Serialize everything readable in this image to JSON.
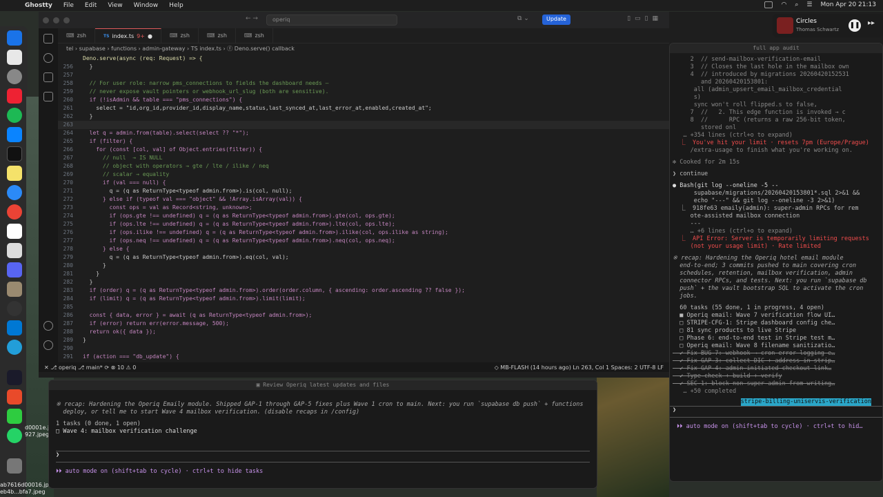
{
  "menubar": {
    "app": "Ghostty",
    "items": [
      "File",
      "Edit",
      "View",
      "Window",
      "Help"
    ],
    "datetime": "Mon Apr 20  21:13"
  },
  "music": {
    "title": "Circles",
    "artist": "Thomas Schwartz"
  },
  "desktop": {
    "files": [
      "ab7616d00016.jpeg",
      "eb4b...bfa7.jpeg",
      "d0001e.jpeg",
      "927.jpeg"
    ]
  },
  "vscode": {
    "search_placeholder": "operiq",
    "update_label": "Update",
    "tabs": [
      {
        "label": "zsh"
      },
      {
        "label": "index.ts",
        "badge": "9+",
        "active": true
      },
      {
        "label": "zsh"
      },
      {
        "label": "zsh"
      },
      {
        "label": "zsh"
      }
    ],
    "breadcrumb": "tel  ›  supabase  ›  functions  ›  admin-gateway  ›  TS index.ts  ›  ⓕ Deno.serve() callback",
    "header_line": "Deno.serve(async (req: Request) => {",
    "lines": [
      {
        "n": "256",
        "t": "  }"
      },
      {
        "n": "257",
        "t": ""
      },
      {
        "n": "258",
        "t": "  // For user role: narrow pms_connections to fields the dashboard needs —",
        "c": "cm"
      },
      {
        "n": "259",
        "t": "  // never expose vault pointers or webhook_url_slug (both are sensitive).",
        "c": "cm"
      },
      {
        "n": "260",
        "t": "  if (!isAdmin && table === \"pms_connections\") {"
      },
      {
        "n": "261",
        "t": "    select = \"id,org_id,provider_id,display_name,status,last_synced_at,last_error_at,enabled,created_at\";"
      },
      {
        "n": "262",
        "t": "  }"
      },
      {
        "n": "263",
        "t": ""
      },
      {
        "n": "264",
        "t": "  let q = admin.from(table).select(select ?? \"*\");"
      },
      {
        "n": "265",
        "t": "  if (filter) {"
      },
      {
        "n": "266",
        "t": "    for (const [col, val] of Object.entries(filter)) {"
      },
      {
        "n": "267",
        "t": "      // null  → IS NULL",
        "c": "cm"
      },
      {
        "n": "268",
        "t": "      // object with operators → gte / lte / ilike / neq",
        "c": "cm"
      },
      {
        "n": "269",
        "t": "      // scalar → equality",
        "c": "cm"
      },
      {
        "n": "270",
        "t": "      if (val === null) {"
      },
      {
        "n": "271",
        "t": "        q = (q as ReturnType<typeof admin.from>).is(col, null);"
      },
      {
        "n": "272",
        "t": "      } else if (typeof val === \"object\" && !Array.isArray(val)) {"
      },
      {
        "n": "273",
        "t": "        const ops = val as Record<string, unknown>;"
      },
      {
        "n": "274",
        "t": "        if (ops.gte !== undefined) q = (q as ReturnType<typeof admin.from>).gte(col, ops.gte);"
      },
      {
        "n": "275",
        "t": "        if (ops.lte !== undefined) q = (q as ReturnType<typeof admin.from>).lte(col, ops.lte);"
      },
      {
        "n": "276",
        "t": "        if (ops.ilike !== undefined) q = (q as ReturnType<typeof admin.from>).ilike(col, ops.ilike as string);"
      },
      {
        "n": "277",
        "t": "        if (ops.neq !== undefined) q = (q as ReturnType<typeof admin.from>).neq(col, ops.neq);"
      },
      {
        "n": "278",
        "t": "      } else {"
      },
      {
        "n": "279",
        "t": "        q = (q as ReturnType<typeof admin.from>).eq(col, val);"
      },
      {
        "n": "280",
        "t": "      }"
      },
      {
        "n": "281",
        "t": "    }"
      },
      {
        "n": "282",
        "t": "  }"
      },
      {
        "n": "283",
        "t": "  if (order) q = (q as ReturnType<typeof admin.from>).order(order.column, { ascending: order.ascending ?? false });"
      },
      {
        "n": "284",
        "t": "  if (limit) q = (q as ReturnType<typeof admin.from>).limit(limit);"
      },
      {
        "n": "285",
        "t": ""
      },
      {
        "n": "286",
        "t": "  const { data, error } = await (q as ReturnType<typeof admin.from>);"
      },
      {
        "n": "287",
        "t": "  if (error) return err(error.message, 500);"
      },
      {
        "n": "288",
        "t": "  return ok({ data });"
      },
      {
        "n": "289",
        "t": "}"
      },
      {
        "n": "290",
        "t": ""
      },
      {
        "n": "291",
        "t": "if (action === \"db_update\") {"
      }
    ],
    "status_left": "✕  ⎇ operiq  ⎇ main*  ⟳  ⊗ 10 ⚠ 0",
    "status_right": "◇ MB-FLASH (14 hours ago)   Ln 263, Col 1   Spaces: 2   UTF-8   LF"
  },
  "term_left": {
    "title": "Review Operiq latest updates and files",
    "recap": "※ recap: Hardening the Operiq Emaily module. Shipped GAP-1 through GAP-5 fixes plus Wave 1 cron to main. Next: you run `supabase db push` + functions",
    "recap2": "  deploy, or tell me to start Wave 4 mailbox verification. (disable recaps in /config)",
    "tasks_header": "1 tasks (0 done, 1 open)",
    "task1": "□ Wave 4: mailbox verification challenge",
    "prompt": "❯",
    "mode": "⏵⏵ auto mode on (shift+tab to cycle) · ctrl+t to hide tasks"
  },
  "term_right": {
    "title": "full app audit",
    "lines": [
      {
        "t": "     2  // send-mailbox-verification-email",
        "c": "dim"
      },
      {
        "t": "     3  // Closes the last hole in the mailbox own",
        "c": "dim"
      },
      {
        "t": "     4  // introduced by migrations 20260420152531",
        "c": "dim"
      },
      {
        "t": "        and 20260420153801:",
        "c": "dim"
      },
      {
        "t": "      all (admin_upsert_email_mailbox_credential",
        "c": "dim"
      },
      {
        "t": "      s)",
        "c": "dim"
      },
      {
        "t": "      sync won't roll flipped.s to false,",
        "c": "dim"
      },
      {
        "t": "     7  //   2. This edge function is invoked → c",
        "c": "dim"
      },
      {
        "t": "     8  //      RPC (returns a raw 256-bit token,",
        "c": "dim"
      },
      {
        "t": "        stored onl",
        "c": "dim"
      },
      {
        "t": "   … +354 lines (ctrl+o to expand)",
        "c": "dim"
      },
      {
        "t": "  ⎿  You've hit your limit · resets 7pm (Europe/Prague)",
        "c": "red"
      },
      {
        "t": "     /extra-usage to finish what you're working on.",
        "c": "dim"
      },
      {
        "t": ""
      },
      {
        "t": "✻ Cooked for 2m 15s",
        "c": "dim"
      },
      {
        "t": ""
      },
      {
        "t": "❯ continue",
        "c": ""
      },
      {
        "t": ""
      },
      {
        "t": "● Bash(git log --oneline -5 --",
        "c": "grn"
      },
      {
        "t": "      supabase/migrations/20260420153801*.sql 2>&1 &&",
        "c": ""
      },
      {
        "t": "      echo \"---\" && git log --oneline -3 2>&1)",
        "c": ""
      },
      {
        "t": "  ⎿  918fe63 emaily(admin): super-admin RPCs for rem",
        "c": ""
      },
      {
        "t": "     ote-assisted mailbox connection",
        "c": ""
      },
      {
        "t": "     ---",
        "c": ""
      },
      {
        "t": "     … +6 lines (ctrl+o to expand)",
        "c": "dim"
      },
      {
        "t": "  ⎿  API Error: Server is temporarily limiting requests",
        "c": "red"
      },
      {
        "t": "     (not your usage limit) · Rate limited",
        "c": "red"
      },
      {
        "t": ""
      },
      {
        "t": "※ recap: Hardening the Operiq hotel email module",
        "c": "it"
      },
      {
        "t": "  end-to-end; 3 commits pushed to main covering cron",
        "c": "it"
      },
      {
        "t": "  schedules, retention, mailbox verification, admin",
        "c": "it"
      },
      {
        "t": "  connector RPCs, and tests. Next: you run `supabase db",
        "c": "it"
      },
      {
        "t": "  push` + the vault bootstrap SQL to activate the cron",
        "c": "it"
      },
      {
        "t": "  jobs.",
        "c": "it"
      },
      {
        "t": ""
      },
      {
        "t": "  60 tasks (55 done, 1 in progress, 4 open)",
        "c": ""
      },
      {
        "t": "  ■ Operiq email: Wave 7 verification flow UI…",
        "c": ""
      },
      {
        "t": "  □ STRIPE-CFG-1: Stripe dashboard config che…",
        "c": ""
      },
      {
        "t": "  □ 81 sync products to live Stripe",
        "c": ""
      },
      {
        "t": "  □ Phase 6: end-to-end test in Stripe test m…",
        "c": ""
      },
      {
        "t": "  □ Operiq email: Wave 8 filename sanitizatio…",
        "c": ""
      },
      {
        "t": "  ✔ Fix BUG-7: webhook → cron error logging e…",
        "c": "strike"
      },
      {
        "t": "  ✔ Fix GAP-3: collect DIC + address in strip…",
        "c": "strike"
      },
      {
        "t": "  ✔ Fix GAP-4: admin-initiated checkout link…",
        "c": "strike"
      },
      {
        "t": "  ✔ Type-check + build + verify",
        "c": "strike"
      },
      {
        "t": "  ✔ SEC-1: block non-super-admin from writing…",
        "c": "strike"
      },
      {
        "t": "   … +50 completed",
        "c": "dim"
      }
    ],
    "branch": "stripe-billing-uniservis-verification",
    "prompt": "❯",
    "mode": "⏵⏵ auto mode on (shift+tab to cycle) · ctrl+t to hid…"
  }
}
